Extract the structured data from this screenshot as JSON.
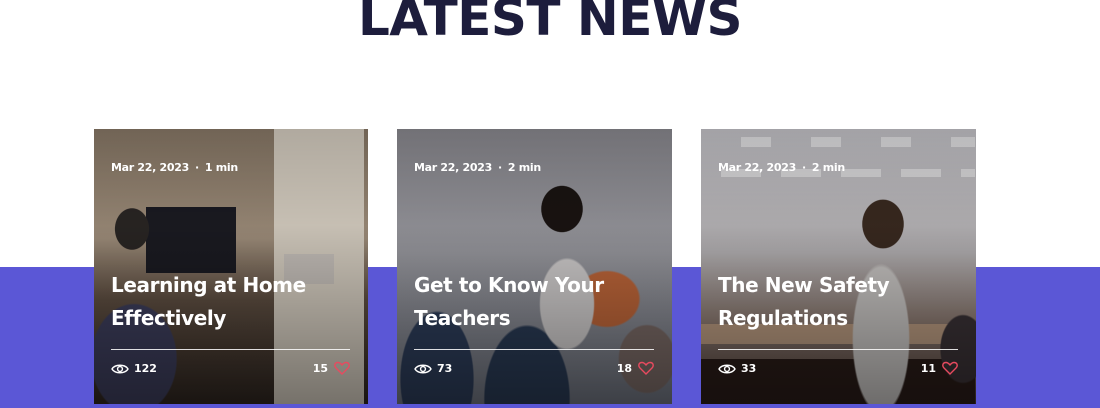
{
  "section": {
    "title": "LATEST NEWS"
  },
  "colors": {
    "accent_band": "#5b57d6",
    "title": "#1d1d3c",
    "heart": "#e84a5f"
  },
  "posts": [
    {
      "date": "Mar 22, 2023",
      "read_time": "1 min",
      "title": "Learning at Home Effectively",
      "views": "122",
      "likes": "15",
      "icons": {
        "views": "eye-icon",
        "likes": "heart-icon"
      }
    },
    {
      "date": "Mar 22, 2023",
      "read_time": "2 min",
      "title": "Get to Know Your Teachers",
      "views": "73",
      "likes": "18",
      "icons": {
        "views": "eye-icon",
        "likes": "heart-icon"
      }
    },
    {
      "date": "Mar 22, 2023",
      "read_time": "2 min",
      "title": "The New Safety Regulations",
      "views": "33",
      "likes": "11",
      "icons": {
        "views": "eye-icon",
        "likes": "heart-icon"
      }
    }
  ]
}
